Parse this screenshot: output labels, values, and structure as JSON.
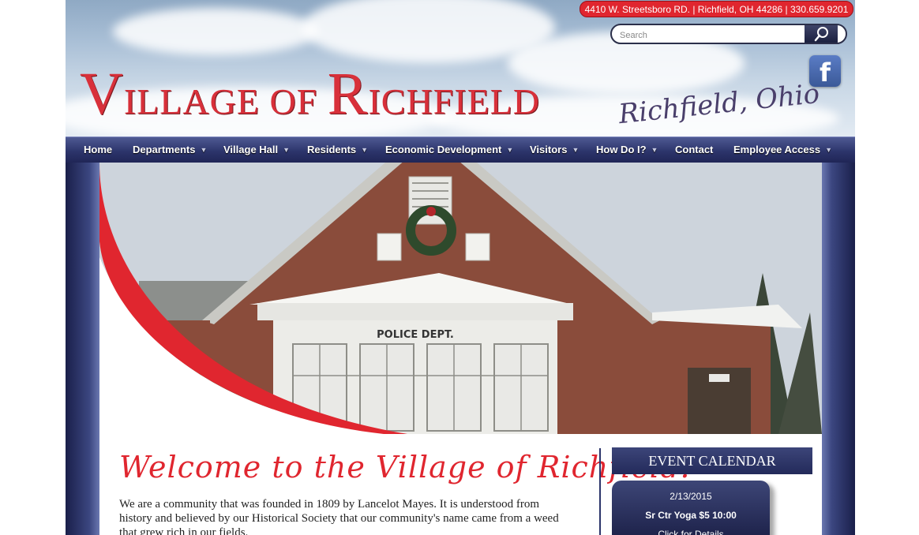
{
  "header": {
    "logo_first": "V",
    "logo_first_rest": "ILLAGE OF ",
    "logo_second": "R",
    "logo_second_rest": "ICHFIELD",
    "tagline": "Richfield, Ohio",
    "address": "4410 W. Streetsboro RD. | Richfield, OH 44286 | 330.659.9201",
    "search_placeholder": "Search",
    "facebook_glyph": "f"
  },
  "nav": [
    {
      "label": "Home",
      "has_dropdown": false
    },
    {
      "label": "Departments",
      "has_dropdown": true
    },
    {
      "label": "Village Hall",
      "has_dropdown": true
    },
    {
      "label": "Residents",
      "has_dropdown": true
    },
    {
      "label": "Economic Development",
      "has_dropdown": true
    },
    {
      "label": "Visitors",
      "has_dropdown": true
    },
    {
      "label": "How Do I?",
      "has_dropdown": true
    },
    {
      "label": "Contact",
      "has_dropdown": false
    },
    {
      "label": "Employee Access",
      "has_dropdown": true
    }
  ],
  "hero": {
    "sign_text": "POLICE DEPT."
  },
  "main": {
    "welcome": "Welcome to the Village of Richfield.",
    "intro": "We are a community that was founded in 1809 by Lancelot Mayes. It is understood from history and believed by our Historical Society that our community's name came from a weed that grew rich in our fields."
  },
  "calendar": {
    "title": "EVENT CALENDAR",
    "event_date": "2/13/2015",
    "event_title": "Sr Ctr Yoga $5 10:00",
    "event_link": "Click for Details"
  },
  "colors": {
    "accent_red": "#e0262f",
    "nav_blue": "#2c346b"
  },
  "icons": {
    "search": "magnifier-icon",
    "facebook": "facebook-icon",
    "dropdown": "caret-down-icon"
  }
}
